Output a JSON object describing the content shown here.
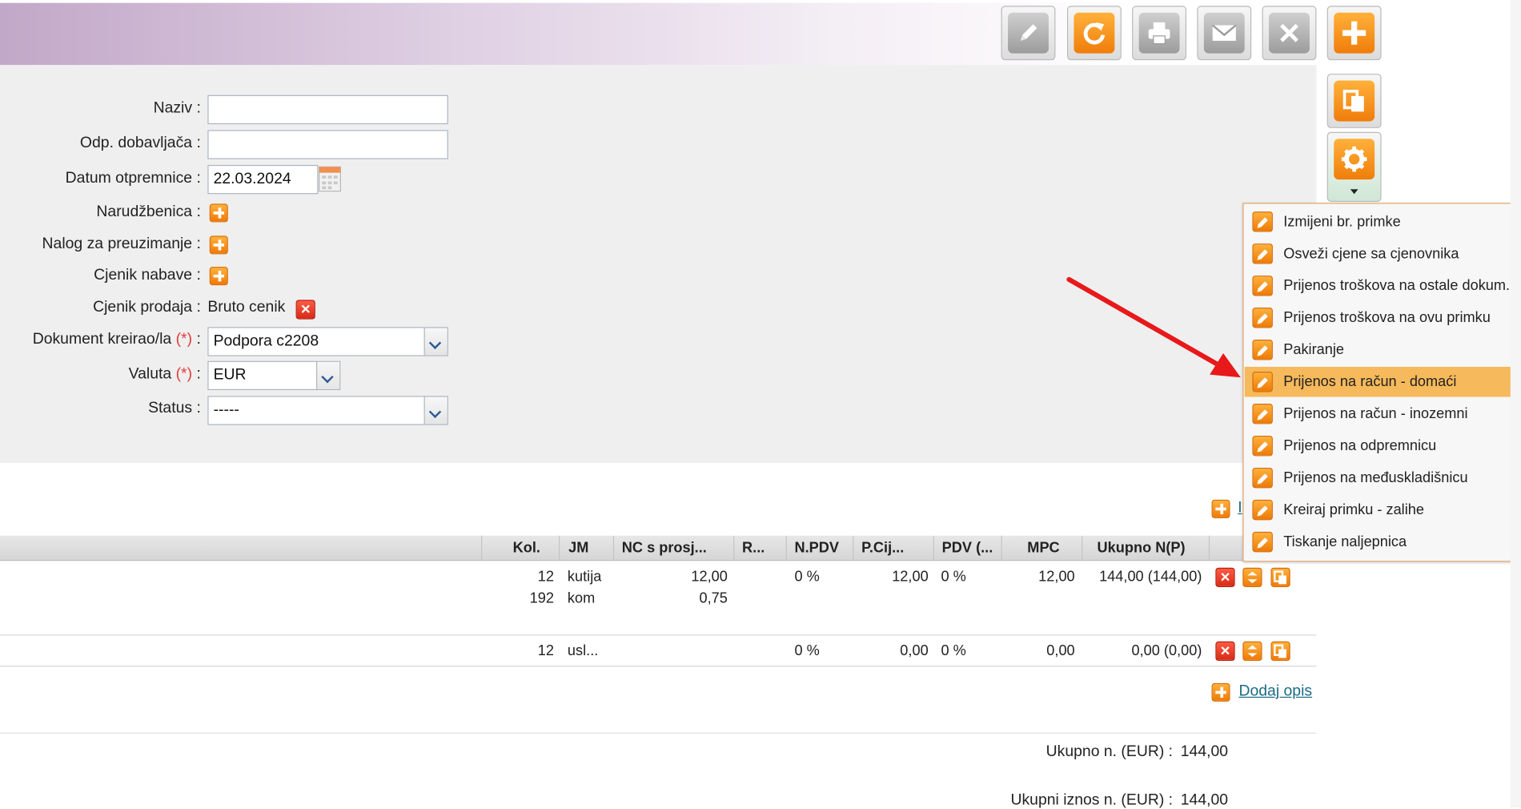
{
  "form": {
    "naziv_label": "Naziv :",
    "naziv_value": "",
    "odp_label": "Odp. dobavljača :",
    "odp_value": "",
    "datum_label": "Datum otpremnice :",
    "datum_value": "22.03.2024",
    "narudzbenica_label": "Narudžbenica :",
    "nalog_label": "Nalog za preuzimanje :",
    "cjenik_nabave_label": "Cjenik nabave :",
    "cjenik_prodaja_label": "Cjenik prodaja :",
    "cjenik_prodaja_value": "Bruto cenik",
    "dokument_label": "Dokument kreirao/la",
    "dokument_value": "Podpora c2208",
    "valuta_label": "Valuta",
    "valuta_value": "EUR",
    "status_label": "Status :",
    "status_value": "-----",
    "required_mark": "(*)",
    "colon": ":"
  },
  "table": {
    "headers": [
      "Kol.",
      "JM",
      "NC s prosj...",
      "R...",
      "N.PDV",
      "P.Cij...",
      "PDV (...",
      "MPC",
      "Ukupno N(P)"
    ],
    "row1": {
      "kol": "12",
      "jm": "kutija",
      "nc": "12,00",
      "npdv": "0 %",
      "pcij": "12,00",
      "pdv": "0 %",
      "mpc": "12,00",
      "ukupno": "144,00 (144,00)"
    },
    "row1b": {
      "kol": "192",
      "jm": "kom",
      "nc": "0,75"
    },
    "row2": {
      "kol": "12",
      "jm": "usl...",
      "npdv": "0 %",
      "pcij": "0,00",
      "pdv": "0 %",
      "mpc": "0,00",
      "ukupno": "0,00 (0,00)"
    },
    "top_link_partial": "I"
  },
  "footer": {
    "dodaj_opis": "Dodaj opis",
    "ukupno_label": "Ukupno n. (EUR) :",
    "ukupno_value": "144,00",
    "ukupni_iznos_label": "Ukupni iznos n. (EUR) :",
    "ukupni_iznos_value": "144,00"
  },
  "menu": {
    "items": [
      "Izmijeni br. primke",
      "Osveži cjene sa cjenovnika",
      "Prijenos troškova na ostale dokum.",
      "Prijenos troškova na ovu primku",
      "Pakiranje",
      "Prijenos na račun - domaći",
      "Prijenos na račun - inozemni",
      "Prijenos na odpremnicu",
      "Prijenos na međuskladišnicu",
      "Kreiraj primku - zalihe",
      "Tiskanje naljepnica"
    ],
    "highlighted_index": 5
  },
  "toolbar": {
    "buttons": [
      "edit-icon",
      "refresh-icon",
      "print-icon",
      "mail-icon",
      "close-icon",
      "add-icon",
      "copy-icon",
      "gear-icon"
    ]
  },
  "colors": {
    "accent_orange": "#f07d0a",
    "menu_highlight": "#f6b95b",
    "header_purple": "#c2a8c8",
    "arrow_red": "#e8191b"
  }
}
